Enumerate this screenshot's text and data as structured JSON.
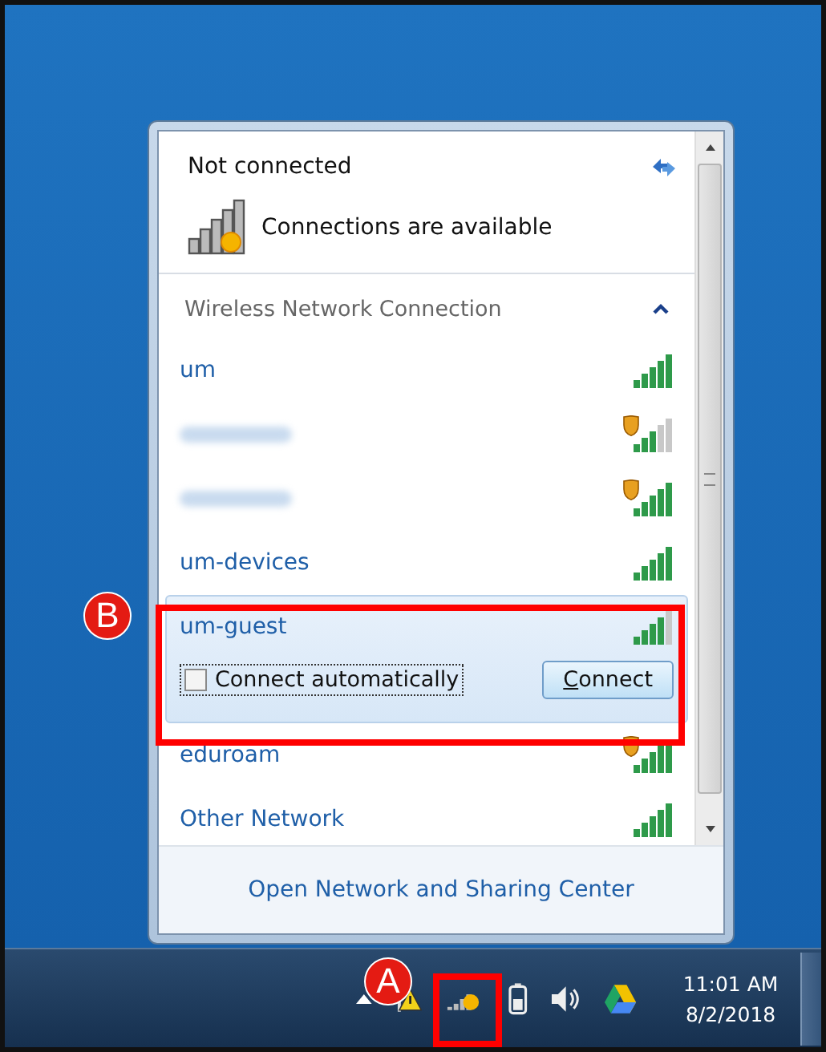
{
  "popup": {
    "status": "Not connected",
    "availability": "Connections are available",
    "section": {
      "title": "Wireless Network Connection",
      "expanded": true
    },
    "networks": [
      {
        "kind": "named",
        "name": "um",
        "level": 1,
        "secured": false,
        "selected": false
      },
      {
        "kind": "obscured",
        "level": 0.6,
        "secured": true,
        "selected": false
      },
      {
        "kind": "obscured",
        "level": 1,
        "secured": true,
        "selected": false
      },
      {
        "kind": "named",
        "name": "um-devices",
        "level": 1,
        "secured": false,
        "selected": false
      },
      {
        "kind": "named",
        "name": "um-guest",
        "level": 0.8,
        "secured": false,
        "selected": true,
        "auto_connect": {
          "label": "Connect automatically",
          "checked": false
        },
        "button": "Connect"
      },
      {
        "kind": "named",
        "name": "eduroam",
        "level": 1,
        "secured": true,
        "selected": false
      },
      {
        "kind": "named",
        "name": "Other Network",
        "level": 1,
        "secured": false,
        "selected": false
      }
    ],
    "footer_link": "Open Network and Sharing Center"
  },
  "taskbar": {
    "time": "11:01 AM",
    "date": "8/2/2018"
  },
  "callouts": [
    {
      "label": "A"
    },
    {
      "label": "B"
    }
  ]
}
